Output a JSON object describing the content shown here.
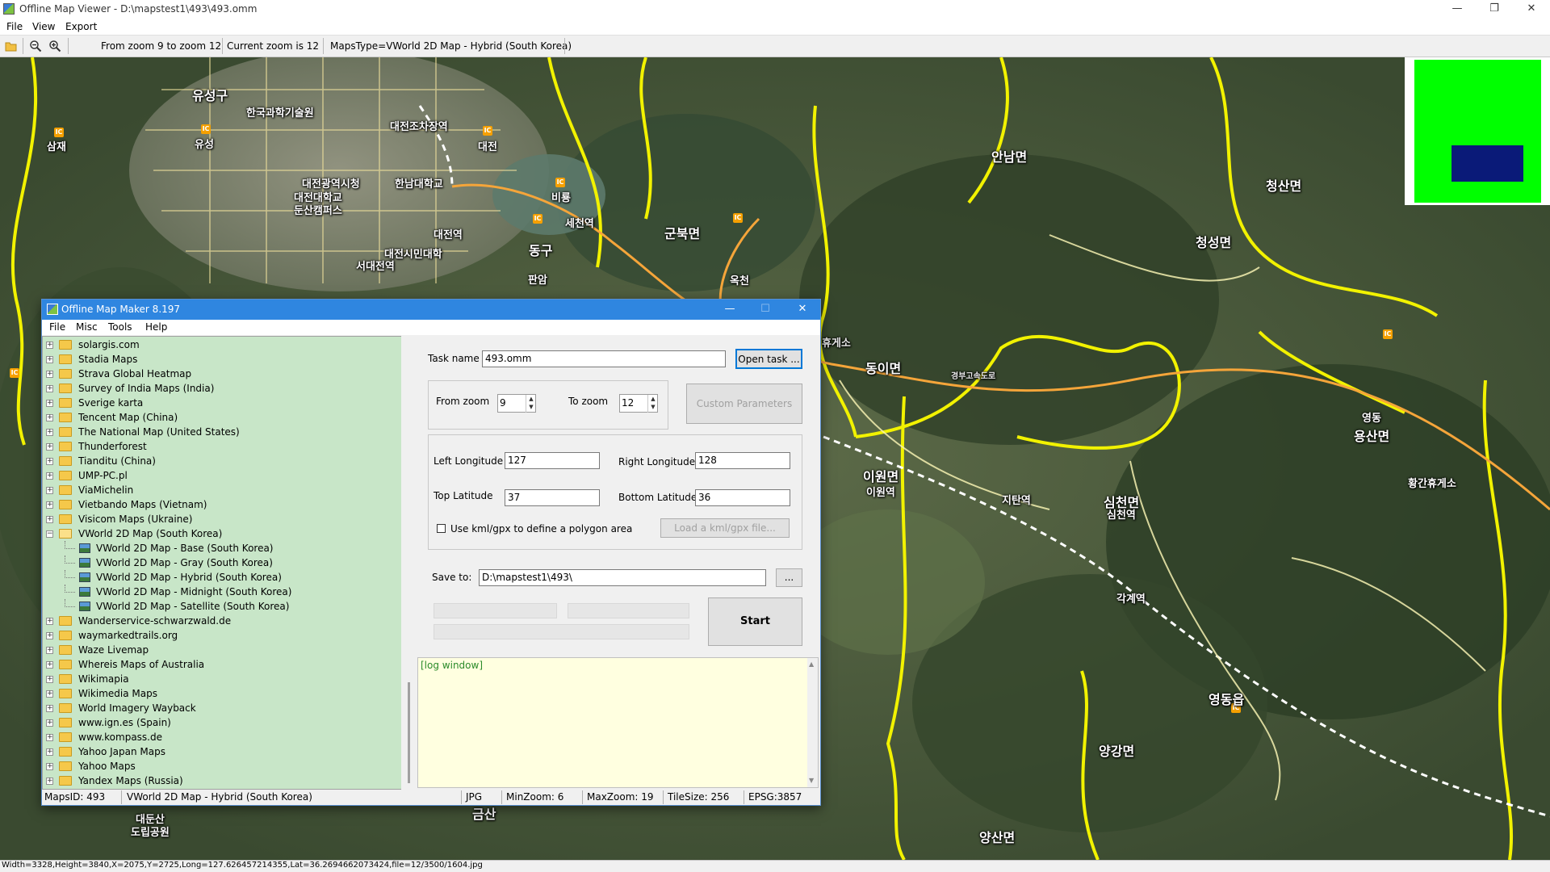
{
  "window": {
    "title": "Offline Map Viewer - D:\\mapstest1\\493\\493.omm",
    "minimize": "—",
    "restore": "❐",
    "close": "✕"
  },
  "menu": {
    "file": "File",
    "view": "View",
    "export": "Export"
  },
  "toolbar": {
    "zoom_range": "From zoom 9 to zoom 12",
    "current_zoom": "Current zoom is 12",
    "maps_type": "MapsType=VWorld 2D Map - Hybrid (South Korea)"
  },
  "map_labels": [
    {
      "text": "유성구"
    },
    {
      "text": "한국과학기술원"
    },
    {
      "text": "대전조차장역"
    },
    {
      "text": "대전광역시청"
    },
    {
      "text": "대전대학교"
    },
    {
      "text": "둔산캠퍼스"
    },
    {
      "text": "한남대학교"
    },
    {
      "text": "대전역"
    },
    {
      "text": "대전시민대학"
    },
    {
      "text": "서대전역"
    },
    {
      "text": "동구"
    },
    {
      "text": "세천역"
    },
    {
      "text": "군북면"
    },
    {
      "text": "비룡"
    },
    {
      "text": "판암"
    },
    {
      "text": "옥천"
    },
    {
      "text": "안남면"
    },
    {
      "text": "청산면"
    },
    {
      "text": "청성면"
    },
    {
      "text": "동이면"
    },
    {
      "text": "이원면"
    },
    {
      "text": "이원역"
    },
    {
      "text": "지탄역"
    },
    {
      "text": "심천면"
    },
    {
      "text": "심천역"
    },
    {
      "text": "각계역"
    },
    {
      "text": "용산면"
    },
    {
      "text": "영동"
    },
    {
      "text": "황간휴게소"
    },
    {
      "text": "영동읍"
    },
    {
      "text": "양강면"
    },
    {
      "text": "양산면"
    },
    {
      "text": "금산"
    },
    {
      "text": "대둔산"
    },
    {
      "text": "도립공원"
    },
    {
      "text": "삼재"
    },
    {
      "text": "유성"
    },
    {
      "text": "대전"
    },
    {
      "text": "휴게소"
    },
    {
      "text": "경부고속도로"
    }
  ],
  "status_bar": "Width=3328,Height=3840,X=2075,Y=2725,Long=127.626457214355,Lat=36.2694662073424,file=12/3500/1604.jpg",
  "minimap": {
    "fill_color": "#00ff00",
    "view_color": "#0a1a78"
  },
  "dialog": {
    "title": "Offline Map Maker 8.197",
    "menu": {
      "file": "File",
      "misc": "Misc",
      "tools": "Tools",
      "help": "Help"
    },
    "tree": [
      {
        "label": "solargis.com",
        "type": "folder"
      },
      {
        "label": "Stadia Maps",
        "type": "folder"
      },
      {
        "label": "Strava Global Heatmap",
        "type": "folder"
      },
      {
        "label": "Survey of India Maps (India)",
        "type": "folder"
      },
      {
        "label": "Sverige karta",
        "type": "folder"
      },
      {
        "label": "Tencent Map (China)",
        "type": "folder"
      },
      {
        "label": "The National Map (United States)",
        "type": "folder"
      },
      {
        "label": "Thunderforest",
        "type": "folder"
      },
      {
        "label": "Tianditu (China)",
        "type": "folder"
      },
      {
        "label": "UMP-PC.pl",
        "type": "folder"
      },
      {
        "label": "ViaMichelin",
        "type": "folder"
      },
      {
        "label": "Vietbando Maps (Vietnam)",
        "type": "folder"
      },
      {
        "label": "Visicom Maps (Ukraine)",
        "type": "folder"
      },
      {
        "label": "VWorld 2D Map (South Korea)",
        "type": "folder-open"
      },
      {
        "label": "VWorld 2D Map - Base (South Korea)",
        "type": "map"
      },
      {
        "label": "VWorld 2D Map - Gray (South Korea)",
        "type": "map"
      },
      {
        "label": "VWorld 2D Map - Hybrid (South Korea)",
        "type": "map"
      },
      {
        "label": "VWorld 2D Map - Midnight (South Korea)",
        "type": "map"
      },
      {
        "label": "VWorld 2D Map - Satellite (South Korea)",
        "type": "map"
      },
      {
        "label": "Wanderservice-schwarzwald.de",
        "type": "folder"
      },
      {
        "label": "waymarkedtrails.org",
        "type": "folder"
      },
      {
        "label": "Waze Livemap",
        "type": "folder"
      },
      {
        "label": "Whereis Maps of Australia",
        "type": "folder"
      },
      {
        "label": "Wikimapia",
        "type": "folder"
      },
      {
        "label": "Wikimedia Maps",
        "type": "folder"
      },
      {
        "label": "World Imagery Wayback",
        "type": "folder"
      },
      {
        "label": "www.ign.es (Spain)",
        "type": "folder"
      },
      {
        "label": "www.kompass.de",
        "type": "folder"
      },
      {
        "label": "Yahoo Japan Maps",
        "type": "folder"
      },
      {
        "label": "Yahoo Maps",
        "type": "folder"
      },
      {
        "label": "Yandex Maps (Russia)",
        "type": "folder"
      }
    ],
    "task_name_label": "Task name",
    "task_name_value": "493.omm",
    "open_task": "Open task ...",
    "from_zoom_label": "From zoom",
    "from_zoom_value": "9",
    "to_zoom_label": "To zoom",
    "to_zoom_value": "12",
    "custom_parameters": "Custom Parameters",
    "left_longitude_label": "Left Longitude",
    "left_longitude_value": "127",
    "right_longitude_label": "Right Longitude",
    "right_longitude_value": "128",
    "top_latitude_label": "Top Latitude",
    "top_latitude_value": "37",
    "bottom_latitude_label": "Bottom Latitude",
    "bottom_latitude_value": "36",
    "use_kml_label": "Use kml/gpx to define a polygon area",
    "use_kml_checked": false,
    "load_kml": "Load a kml/gpx file...",
    "save_to_label": "Save to:",
    "save_to_value": "D:\\mapstest1\\493\\",
    "browse": "...",
    "start": "Start",
    "log": "[log window]",
    "status": {
      "maps_id": "MapsID: 493",
      "map_name": "VWorld 2D Map - Hybrid (South Korea)",
      "format": "JPG",
      "min_zoom": "MinZoom: 6",
      "max_zoom": "MaxZoom: 19",
      "tile_size": "TileSize: 256",
      "epsg": "EPSG:3857"
    }
  }
}
